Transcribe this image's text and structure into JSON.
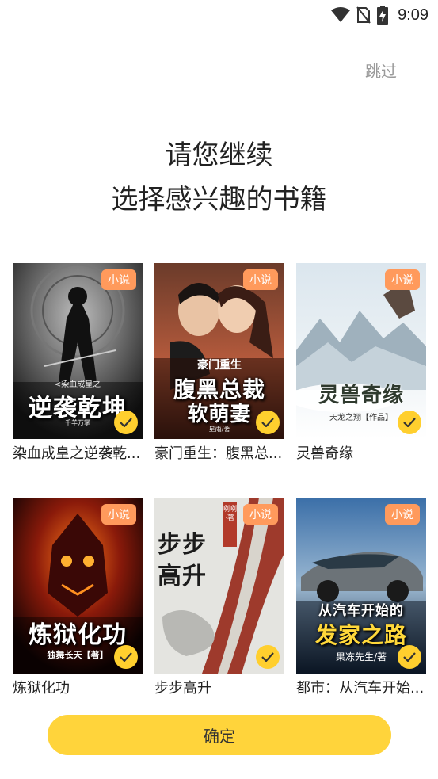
{
  "status_bar": {
    "time": "9:09",
    "icons": [
      "wifi-icon",
      "no-sim-icon",
      "battery-charging-icon"
    ]
  },
  "skip_label": "跳过",
  "headline": {
    "line1": "请您继续",
    "line2": "选择感兴趣的书籍"
  },
  "books": [
    {
      "name": "染血成皇之逆袭乾...",
      "tag": "小说",
      "selected": true,
      "cover_title": "逆袭乾坤",
      "cover_subtitle": "<染血成皇之",
      "cover_author": "千羊万掌"
    },
    {
      "name": "豪门重生：腹黑总...",
      "tag": "小说",
      "selected": true,
      "cover_title": "腹黑总裁",
      "cover_title2": "软萌妻",
      "cover_subtitle": "豪门重生",
      "cover_author": "星雨/著"
    },
    {
      "name": "灵兽奇缘",
      "tag": "小说",
      "selected": true,
      "cover_title": "灵兽奇缘",
      "cover_author": "天龙之翔【作品】"
    },
    {
      "name": "炼狱化功",
      "tag": "小说",
      "selected": true,
      "cover_title": "炼狱化功",
      "cover_author": "独舞长天【著】"
    },
    {
      "name": "步步高升",
      "tag": "小说",
      "selected": true,
      "cover_title": "步步高升",
      "cover_author": "咧咧·著"
    },
    {
      "name": "都市：从汽车开始...",
      "tag": "小说",
      "selected": true,
      "cover_title": "从汽车开始的",
      "cover_title2": "发家之路",
      "cover_author": "果冻先生/著"
    }
  ],
  "confirm_label": "确定",
  "colors": {
    "accent": "#ffd43b",
    "tag": "#ff9a5c",
    "check": "#ffcf2e"
  }
}
